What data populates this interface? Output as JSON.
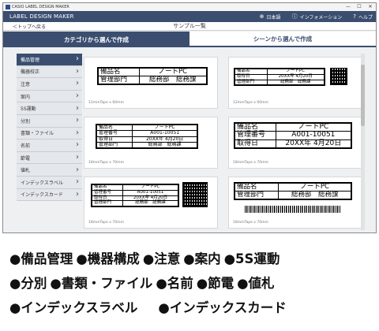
{
  "window": {
    "app_title": "CASIO LABEL DESIGN MAKER",
    "minimize": "—",
    "maximize": "☐",
    "close": "✕"
  },
  "menubar": {
    "title": "LABEL DESIGN MAKER",
    "language": "日本語",
    "information": "インフォメーション",
    "help": "ヘルプ"
  },
  "crumb": {
    "back": "＜トップへ戻る",
    "page_title": "サンプル一覧"
  },
  "tabs": [
    {
      "label": "カテゴリから選んで作成",
      "active": true
    },
    {
      "label": "シーンから選んで作成",
      "active": false
    }
  ],
  "sidebar": {
    "items": [
      {
        "label": "備品管理",
        "active": true
      },
      {
        "label": "機器校正",
        "active": false
      },
      {
        "label": "注意",
        "active": false
      },
      {
        "label": "案内",
        "active": false
      },
      {
        "label": "5S運動",
        "active": false
      },
      {
        "label": "分別",
        "active": false
      },
      {
        "label": "書類・ファイル",
        "active": false
      },
      {
        "label": "名前",
        "active": false
      },
      {
        "label": "節電",
        "active": false
      },
      {
        "label": "値札",
        "active": false
      },
      {
        "label": "インデックスラベル",
        "active": false
      },
      {
        "label": "インデックスカード",
        "active": false
      }
    ]
  },
  "cards": [
    {
      "tape": "12mmTape x 60mm",
      "rows": [
        [
          "備品名",
          "ノートPC"
        ],
        [
          "管理部門",
          "総務部　総務課"
        ]
      ]
    },
    {
      "tape": "12mmTape x 60mm",
      "rows": [
        [
          "備品名",
          "ノートPC"
        ],
        [
          "取得日",
          "20XX年 4月20日"
        ],
        [
          "管理部門",
          "総務部　総務課"
        ]
      ],
      "qr": true
    },
    {
      "tape": "18mmTape x 70mm",
      "rows": [
        [
          "備品名",
          "ノートPC"
        ],
        [
          "管理番号",
          "A001-10051"
        ],
        [
          "取得日",
          "20XX年 4月20日"
        ],
        [
          "管理部門",
          "総務部　総務課"
        ]
      ]
    },
    {
      "tape": "18mmTape x 70mm",
      "rows": [
        [
          "備品名",
          "ノートPC"
        ],
        [
          "管理番号",
          "A001-10051"
        ],
        [
          "取得日",
          "20XX年 4月20日"
        ]
      ]
    },
    {
      "tape": "18mmTape x 70mm",
      "rows": [
        [
          "備品名",
          "ノートPC"
        ],
        [
          "管理番号",
          "A001-10051"
        ],
        [
          "取得日",
          "20XX年 4月20日"
        ],
        [
          "管理部門",
          "総務部　総務課"
        ]
      ],
      "qr": true
    },
    {
      "tape": "18mmTape x 70mm",
      "rows": [
        [
          "備品名",
          "ノートPC"
        ],
        [
          "管理部門",
          "総務部　総務課"
        ]
      ],
      "barcode": true
    }
  ],
  "legend": {
    "row1": [
      "●備品管理",
      "●機器構成",
      "●注意",
      "●案内",
      "●5S運動"
    ],
    "row2": [
      "●分別",
      "●書類・ファイル",
      "●名前",
      "●節電",
      "●値札"
    ],
    "row3": [
      "●インデックスラベル",
      "●インデックスカード"
    ]
  }
}
